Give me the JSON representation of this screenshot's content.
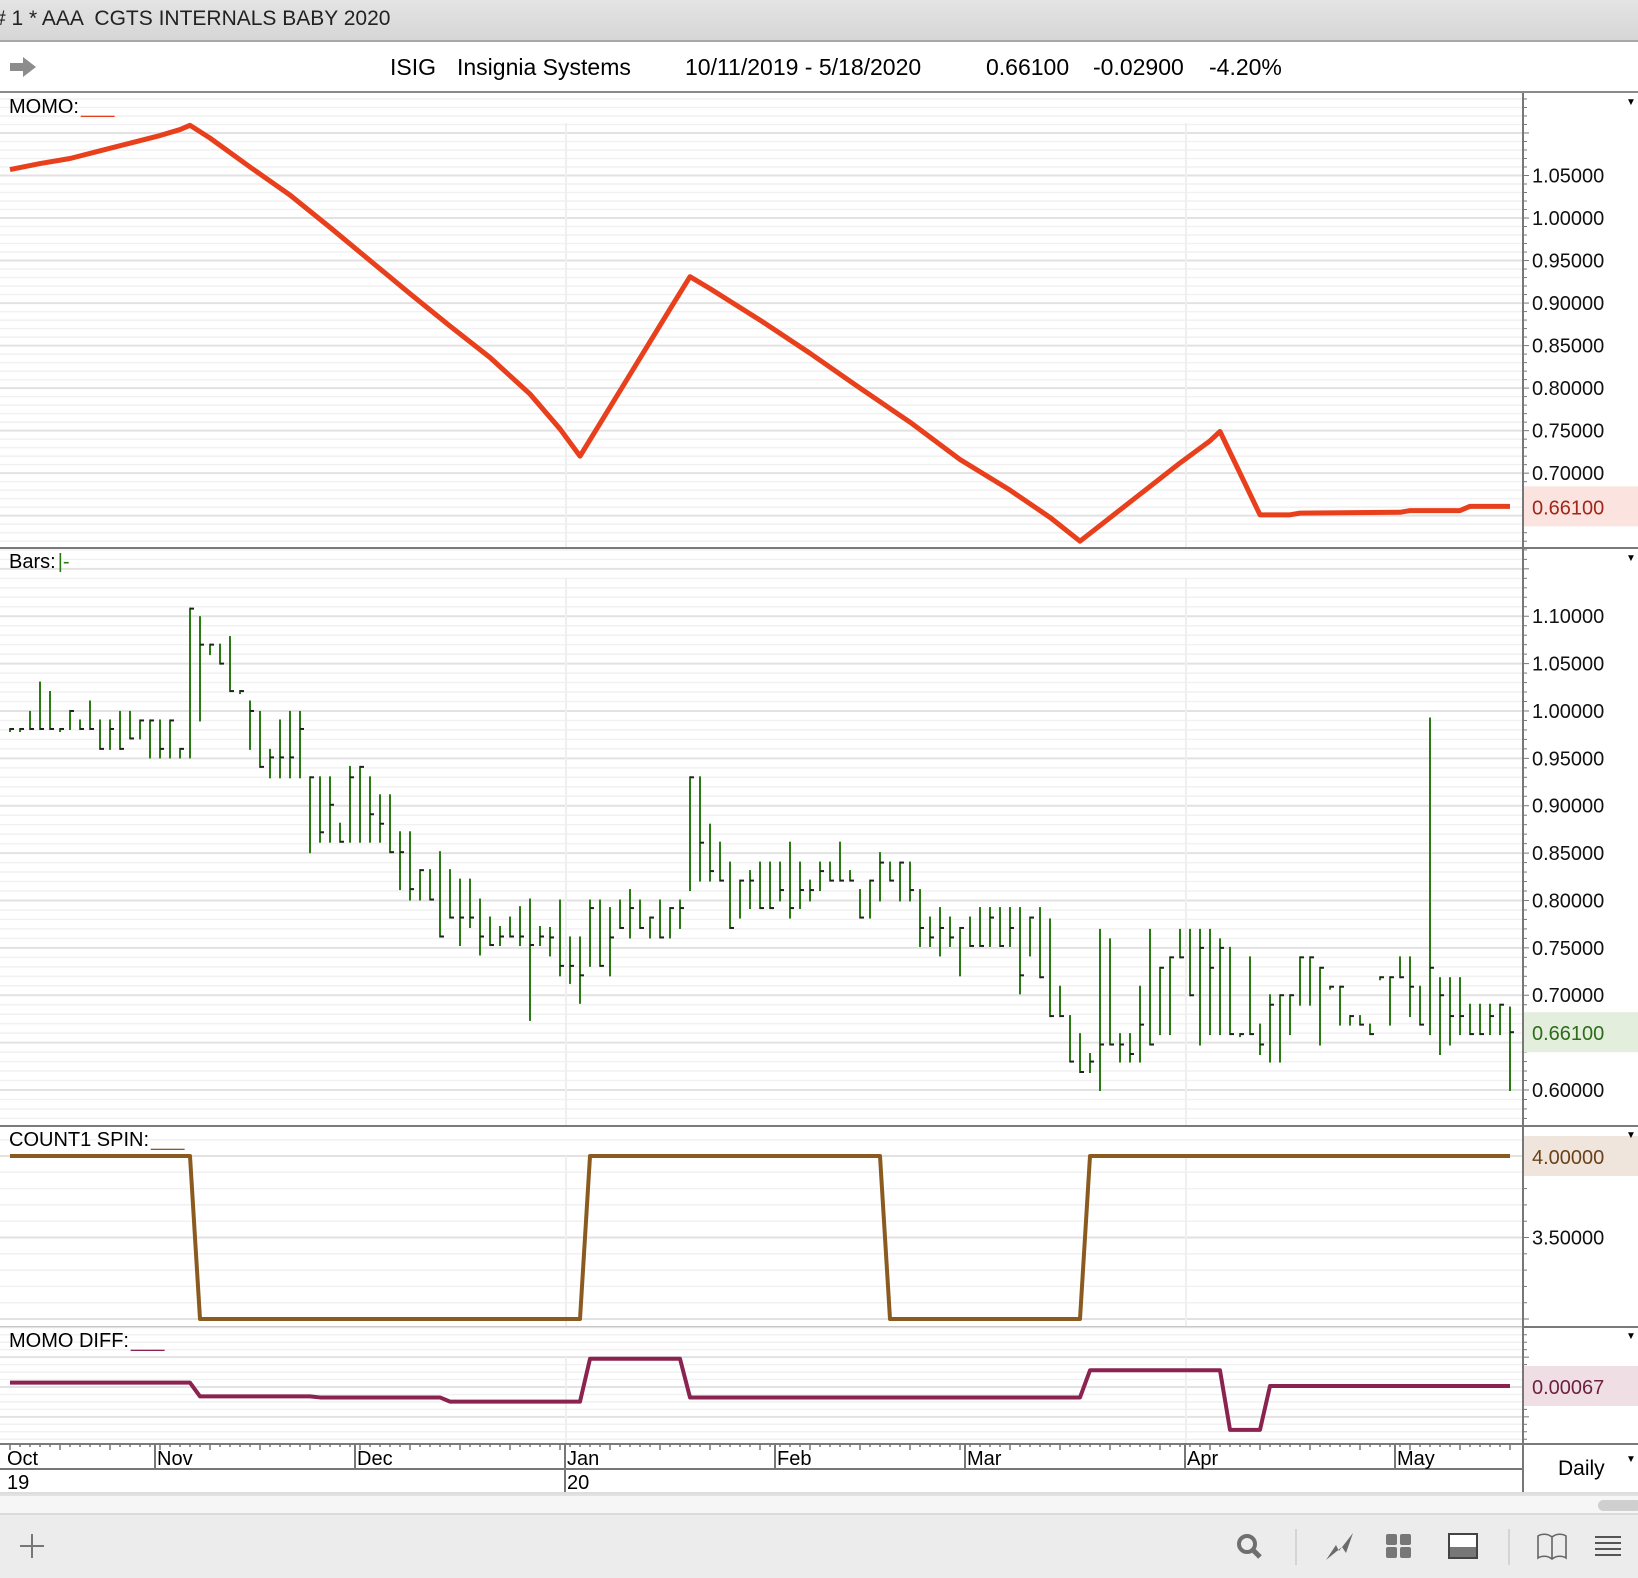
{
  "window": {
    "title": "# 1 * AAA  CGTS INTERNALS BABY 2020"
  },
  "header": {
    "symbol": "ISIG",
    "company": "Insignia Systems",
    "date_range": "10/11/2019 - 5/18/2020",
    "last": "0.66100",
    "change": "-0.02900",
    "change_pct": "-4.20%"
  },
  "panes": {
    "momo": {
      "label": "MOMO:",
      "symbol": "___",
      "color": "#e8401c",
      "box_bg": "#fbe3df",
      "box_text": "#a0271a",
      "current": "0.66100",
      "current_value": 0.661,
      "ylim": [
        0.612,
        1.147
      ],
      "yticks": [
        "1.05000",
        "1.00000",
        "0.95000",
        "0.90000",
        "0.85000",
        "0.80000",
        "0.75000",
        "0.70000"
      ]
    },
    "bars": {
      "label": "Bars:",
      "symbol": "|-",
      "color": "#2a7a14",
      "box_bg": "#e3eedd",
      "box_text": "#2e6b1a",
      "current": "0.66100",
      "current_value": 0.661,
      "ylim": [
        0.562,
        1.172
      ],
      "yticks": [
        "1.10000",
        "1.05000",
        "1.00000",
        "0.95000",
        "0.90000",
        "0.85000",
        "0.80000",
        "0.75000",
        "0.70000",
        "0.60000"
      ]
    },
    "count": {
      "label": "COUNT1 SPIN:",
      "symbol": "___",
      "color": "#8b5a1e",
      "box_bg": "#efe5dc",
      "box_text": "#6b4218",
      "current": "4.00000",
      "current_value": 4.0,
      "ylim": [
        2.951,
        4.184
      ],
      "yticks": [
        "3.50000"
      ]
    },
    "diff": {
      "label": "MOMO DIFF:",
      "symbol": "___",
      "color": "#8a2350",
      "box_bg": "#efdfe4",
      "box_text": "#6e2040",
      "current": "0.00067",
      "current_value": 0.00067,
      "ylim": [
        -0.0382,
        0.0402
      ],
      "yticks": []
    }
  },
  "x_axis": {
    "months": [
      {
        "label": "Oct",
        "index": 0,
        "year": "19"
      },
      {
        "label": "Nov",
        "index": 15
      },
      {
        "label": "Dec",
        "index": 35
      },
      {
        "label": "Jan",
        "index": 56,
        "year": "20"
      },
      {
        "label": "Feb",
        "index": 77
      },
      {
        "label": "Mar",
        "index": 96
      },
      {
        "label": "Apr",
        "index": 118
      },
      {
        "label": "May",
        "index": 139
      }
    ],
    "periodicity": "Daily",
    "bar_count": 151
  },
  "chart_data": [
    {
      "type": "line",
      "title": "MOMO",
      "x_unit": "trading day index from 10/11/2019",
      "points": [
        [
          0,
          1.057
        ],
        [
          3,
          1.064
        ],
        [
          6,
          1.07
        ],
        [
          9,
          1.079
        ],
        [
          12,
          1.088
        ],
        [
          15,
          1.097
        ],
        [
          17,
          1.104
        ],
        [
          18,
          1.109
        ],
        [
          20,
          1.094
        ],
        [
          24,
          1.06
        ],
        [
          28,
          1.027
        ],
        [
          32,
          0.989
        ],
        [
          36,
          0.95
        ],
        [
          40,
          0.911
        ],
        [
          44,
          0.873
        ],
        [
          48,
          0.836
        ],
        [
          52,
          0.793
        ],
        [
          55,
          0.752
        ],
        [
          57,
          0.72
        ],
        [
          62,
          0.816
        ],
        [
          66,
          0.893
        ],
        [
          68,
          0.931
        ],
        [
          70,
          0.917
        ],
        [
          75,
          0.88
        ],
        [
          80,
          0.841
        ],
        [
          85,
          0.8
        ],
        [
          90,
          0.76
        ],
        [
          95,
          0.716
        ],
        [
          100,
          0.68
        ],
        [
          104,
          0.648
        ],
        [
          107,
          0.62
        ],
        [
          112,
          0.666
        ],
        [
          117,
          0.712
        ],
        [
          120,
          0.738
        ],
        [
          121,
          0.749
        ],
        [
          125,
          0.651
        ],
        [
          128,
          0.651
        ],
        [
          129,
          0.653
        ],
        [
          139,
          0.654
        ],
        [
          140,
          0.656
        ],
        [
          145,
          0.656
        ],
        [
          146,
          0.661
        ],
        [
          150,
          0.661
        ]
      ]
    },
    {
      "type": "ohlc",
      "title": "Bars",
      "fields": [
        "high",
        "low",
        "close"
      ],
      "bars": [
        [
          0.981,
          0.981,
          0.981
        ],
        [
          0.981,
          0.981,
          0.981
        ],
        [
          0.999,
          0.981,
          0.981
        ],
        [
          1.03,
          0.981,
          0.981
        ],
        [
          1.02,
          0.981,
          0.981
        ],
        [
          0.981,
          0.981,
          0.981
        ],
        [
          1.0,
          0.981,
          1.0
        ],
        [
          0.99,
          0.981,
          0.981
        ],
        [
          1.01,
          0.981,
          0.981
        ],
        [
          0.99,
          0.96,
          0.96
        ],
        [
          0.99,
          0.96,
          0.981
        ],
        [
          0.999,
          0.96,
          0.96
        ],
        [
          0.999,
          0.971,
          0.971
        ],
        [
          0.99,
          0.971,
          0.99
        ],
        [
          0.99,
          0.951,
          0.99
        ],
        [
          0.99,
          0.951,
          0.96
        ],
        [
          0.99,
          0.951,
          0.99
        ],
        [
          0.96,
          0.951,
          0.96
        ],
        [
          1.108,
          0.951,
          1.108
        ],
        [
          1.099,
          0.99,
          1.07
        ],
        [
          1.07,
          1.06,
          1.07
        ],
        [
          1.07,
          1.05,
          1.05
        ],
        [
          1.078,
          1.021,
          1.021
        ],
        [
          1.021,
          1.021,
          1.021
        ],
        [
          1.01,
          0.96,
          1.0
        ],
        [
          0.999,
          0.941,
          0.941
        ],
        [
          0.959,
          0.93,
          0.951
        ],
        [
          0.99,
          0.93,
          0.951
        ],
        [
          0.999,
          0.93,
          0.951
        ],
        [
          0.999,
          0.93,
          0.981
        ],
        [
          0.93,
          0.851,
          0.93
        ],
        [
          0.93,
          0.862,
          0.872
        ],
        [
          0.93,
          0.862,
          0.901
        ],
        [
          0.881,
          0.862,
          0.862
        ],
        [
          0.941,
          0.862,
          0.93
        ],
        [
          0.941,
          0.862,
          0.941
        ],
        [
          0.93,
          0.862,
          0.891
        ],
        [
          0.911,
          0.862,
          0.881
        ],
        [
          0.911,
          0.851,
          0.851
        ],
        [
          0.872,
          0.812,
          0.851
        ],
        [
          0.872,
          0.801,
          0.812
        ],
        [
          0.832,
          0.801,
          0.832
        ],
        [
          0.832,
          0.801,
          0.801
        ],
        [
          0.851,
          0.762,
          0.762
        ],
        [
          0.832,
          0.782,
          0.782
        ],
        [
          0.822,
          0.753,
          0.782
        ],
        [
          0.822,
          0.772,
          0.782
        ],
        [
          0.801,
          0.743,
          0.762
        ],
        [
          0.782,
          0.753,
          0.753
        ],
        [
          0.772,
          0.753,
          0.762
        ],
        [
          0.782,
          0.762,
          0.762
        ],
        [
          0.793,
          0.753,
          0.762
        ],
        [
          0.801,
          0.674,
          0.753
        ],
        [
          0.772,
          0.753,
          0.762
        ],
        [
          0.771,
          0.742,
          0.761
        ],
        [
          0.8,
          0.721,
          0.731
        ],
        [
          0.761,
          0.713,
          0.731
        ],
        [
          0.761,
          0.692,
          0.721
        ],
        [
          0.8,
          0.731,
          0.792
        ],
        [
          0.8,
          0.731,
          0.731
        ],
        [
          0.792,
          0.721,
          0.761
        ],
        [
          0.8,
          0.771,
          0.771
        ],
        [
          0.811,
          0.761,
          0.792
        ],
        [
          0.8,
          0.771,
          0.771
        ],
        [
          0.782,
          0.761,
          0.782
        ],
        [
          0.8,
          0.761,
          0.761
        ],
        [
          0.792,
          0.761,
          0.792
        ],
        [
          0.8,
          0.771,
          0.792
        ],
        [
          0.93,
          0.811,
          0.93
        ],
        [
          0.93,
          0.821,
          0.861
        ],
        [
          0.88,
          0.821,
          0.831
        ],
        [
          0.861,
          0.821,
          0.821
        ],
        [
          0.84,
          0.771,
          0.771
        ],
        [
          0.821,
          0.782,
          0.821
        ],
        [
          0.831,
          0.792,
          0.821
        ],
        [
          0.84,
          0.792,
          0.792
        ],
        [
          0.84,
          0.792,
          0.792
        ],
        [
          0.84,
          0.8,
          0.811
        ],
        [
          0.861,
          0.782,
          0.792
        ],
        [
          0.84,
          0.792,
          0.811
        ],
        [
          0.821,
          0.8,
          0.811
        ],
        [
          0.84,
          0.811,
          0.831
        ],
        [
          0.84,
          0.821,
          0.821
        ],
        [
          0.861,
          0.821,
          0.821
        ],
        [
          0.831,
          0.821,
          0.821
        ],
        [
          0.811,
          0.782,
          0.782
        ],
        [
          0.821,
          0.782,
          0.821
        ],
        [
          0.85,
          0.8,
          0.84
        ],
        [
          0.84,
          0.821,
          0.821
        ],
        [
          0.84,
          0.8,
          0.84
        ],
        [
          0.84,
          0.8,
          0.811
        ],
        [
          0.811,
          0.752,
          0.771
        ],
        [
          0.782,
          0.752,
          0.761
        ],
        [
          0.792,
          0.742,
          0.771
        ],
        [
          0.782,
          0.752,
          0.761
        ],
        [
          0.771,
          0.721,
          0.771
        ],
        [
          0.782,
          0.752,
          0.752
        ],
        [
          0.792,
          0.752,
          0.752
        ],
        [
          0.792,
          0.752,
          0.782
        ],
        [
          0.792,
          0.752,
          0.752
        ],
        [
          0.792,
          0.752,
          0.771
        ],
        [
          0.792,
          0.702,
          0.721
        ],
        [
          0.782,
          0.742,
          0.782
        ],
        [
          0.792,
          0.719,
          0.719
        ],
        [
          0.78,
          0.678,
          0.678
        ],
        [
          0.709,
          0.678,
          0.678
        ],
        [
          0.678,
          0.63,
          0.63
        ],
        [
          0.659,
          0.619,
          0.619
        ],
        [
          0.638,
          0.619,
          0.63
        ],
        [
          0.769,
          0.6,
          0.648
        ],
        [
          0.759,
          0.648,
          0.648
        ],
        [
          0.659,
          0.63,
          0.648
        ],
        [
          0.659,
          0.63,
          0.638
        ],
        [
          0.709,
          0.63,
          0.669
        ],
        [
          0.769,
          0.648,
          0.648
        ],
        [
          0.729,
          0.659,
          0.729
        ],
        [
          0.74,
          0.659,
          0.74
        ],
        [
          0.769,
          0.74,
          0.74
        ],
        [
          0.769,
          0.7,
          0.7
        ],
        [
          0.769,
          0.648,
          0.75
        ],
        [
          0.769,
          0.659,
          0.729
        ],
        [
          0.759,
          0.659,
          0.75
        ],
        [
          0.75,
          0.659,
          0.659
        ],
        [
          0.659,
          0.659,
          0.659
        ],
        [
          0.74,
          0.659,
          0.659
        ],
        [
          0.669,
          0.638,
          0.648
        ],
        [
          0.7,
          0.63,
          0.69
        ],
        [
          0.7,
          0.63,
          0.7
        ],
        [
          0.7,
          0.659,
          0.7
        ],
        [
          0.74,
          0.69,
          0.74
        ],
        [
          0.74,
          0.69,
          0.74
        ],
        [
          0.729,
          0.648,
          0.729
        ],
        [
          0.709,
          0.709,
          0.709
        ],
        [
          0.709,
          0.669,
          0.709
        ],
        [
          0.678,
          0.669,
          0.678
        ],
        [
          0.678,
          0.669,
          0.669
        ],
        [
          0.669,
          0.659,
          0.659
        ],
        [
          0.719,
          0.719,
          0.719
        ],
        [
          0.719,
          0.669,
          0.719
        ],
        [
          0.74,
          0.719,
          0.719
        ],
        [
          0.74,
          0.678,
          0.709
        ],
        [
          0.709,
          0.669,
          0.669
        ],
        [
          0.992,
          0.659,
          0.729
        ],
        [
          0.718,
          0.638,
          0.7
        ],
        [
          0.718,
          0.648,
          0.678
        ],
        [
          0.718,
          0.659,
          0.678
        ],
        [
          0.69,
          0.659,
          0.659
        ],
        [
          0.69,
          0.659,
          0.659
        ],
        [
          0.69,
          0.659,
          0.678
        ],
        [
          0.69,
          0.659,
          0.69
        ],
        [
          0.687,
          0.6,
          0.661
        ]
      ]
    },
    {
      "type": "line",
      "title": "COUNT1 SPIN",
      "points": [
        [
          0,
          4
        ],
        [
          18,
          4
        ],
        [
          19,
          3
        ],
        [
          57,
          3
        ],
        [
          58,
          4
        ],
        [
          87,
          4
        ],
        [
          88,
          3
        ],
        [
          107,
          3
        ],
        [
          108,
          4
        ],
        [
          150,
          4
        ]
      ]
    },
    {
      "type": "line",
      "title": "MOMO DIFF",
      "points": [
        [
          0,
          0.0029
        ],
        [
          18,
          0.0029
        ],
        [
          19,
          -0.0063
        ],
        [
          30,
          -0.0063
        ],
        [
          31,
          -0.007
        ],
        [
          43,
          -0.007
        ],
        [
          44,
          -0.0098
        ],
        [
          57,
          -0.0098
        ],
        [
          58,
          0.0189
        ],
        [
          67,
          0.0189
        ],
        [
          68,
          -0.007
        ],
        [
          107,
          -0.007
        ],
        [
          108,
          0.0112
        ],
        [
          121,
          0.0112
        ],
        [
          122,
          -0.0287
        ],
        [
          125,
          -0.0287
        ],
        [
          126,
          0.00067
        ],
        [
          150,
          0.00067
        ]
      ]
    }
  ]
}
